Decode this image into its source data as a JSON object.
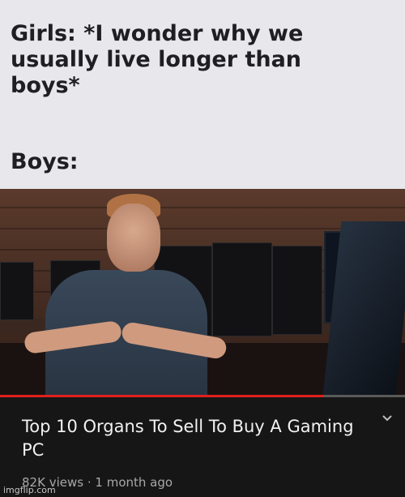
{
  "caption": {
    "setup": "Girls: *I wonder why we\nusually live longer than\nboys*",
    "punchline": "Boys:"
  },
  "video": {
    "progress_fraction": 0.8,
    "title": "Top 10 Organs To Sell To Buy A Gaming PC",
    "views": "82K views",
    "separator": "·",
    "age": "1 month ago",
    "expand_icon": "chevron-down-icon"
  },
  "watermark": "imgflip.com",
  "colors": {
    "progress": "#e0201c",
    "panel": "#161616",
    "caption_bg": "#e8e8ec"
  }
}
